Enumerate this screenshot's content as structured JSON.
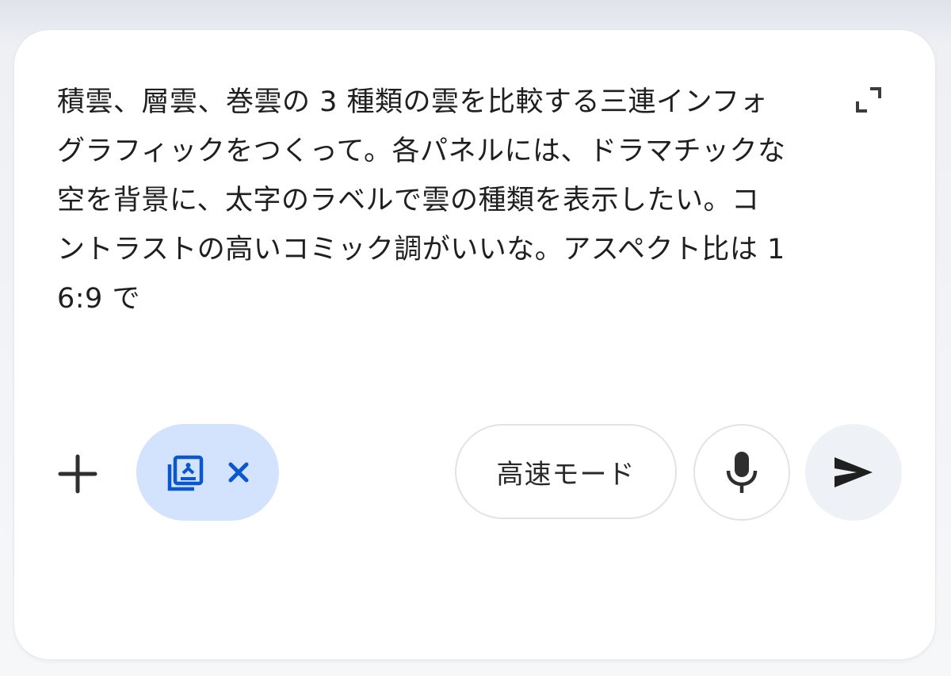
{
  "prompt": {
    "text": "積雲、層雲、巻雲の 3 種類の雲を比較する三連インフォグラフィックをつくって。各パネルには、ドラマチックな空を背景に、太字のラベルで雲の種類を表示したい。コントラストの高いコミック調がいいな。アスペクト比は 16:9 で"
  },
  "toolbar": {
    "add_icon": "plus-icon",
    "attachment_chip": {
      "icon": "image-stack-icon",
      "remove_icon": "close-icon",
      "color": "#d3e3fd",
      "accent": "#0b57d0"
    },
    "mode_label": "高速モード",
    "mic_icon": "microphone-icon",
    "send_icon": "send-icon"
  },
  "expand_icon": "expand-icon"
}
